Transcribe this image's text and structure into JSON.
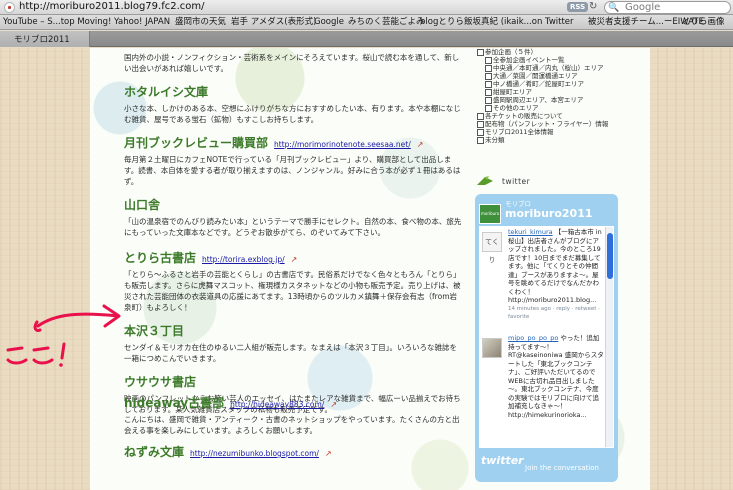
{
  "browser": {
    "url": "http://moriburo2011.blog79.fc2.com/",
    "rss": "RSS",
    "search_placeholder": "Google",
    "bookmarks": [
      "YouTube – S...top Moving!",
      "Yahoo! JAPAN",
      "盛岡市の天気",
      "岩手 アメダス(表形式)",
      "Google",
      "みちのく芸能ごよみ",
      "blogとりら",
      "飯坂真紀 (ikaik...on Twitter",
      "被災者支援チーム...ーEIWATE",
      "とりら画像"
    ],
    "tab_title": "モリブロ2011"
  },
  "main": {
    "top_text": "国内外の小説・ノンフィクション・芸術系をメインにそろえています。桜山で読む本を通して、新しい出会いがあれば嬉しいです。",
    "entries": [
      {
        "name": "ホタルイシ文庫",
        "link": "",
        "desc": "小さな本、しかけのある本、空想にふけりがちな方におすすめしたい本、有ります。本や本棚になじむ雑貨、屋号である蛍石（鉱物）もすこしお持ちします。"
      },
      {
        "name": "月刊ブックレビュー購買部",
        "link": "http://morimorinotenote.seesaa.net/",
        "desc": "毎月第２土曜日にカフェNOTEで行っている「月刊ブックレビュー」より、購買部として出品します。読書、本自体を愛する者が取り揃えますのは、ノンジャンル。好みに合う本が必ず１冊はあるはず。"
      },
      {
        "name": "山口舎",
        "link": "",
        "desc": "「山の温泉宿でのんびり読みたい本」というテーマで勝手にセレクト。自然の本、食べ物の本、旅先にもっていった文庫本などです。どうぞお散歩がてら、のぞいてみて下さい。"
      },
      {
        "name": "とりら古書店",
        "link": "http://torira.exblog.jp/",
        "desc": "「とりら～ふるさと岩手の芸能とくらし」の古書店です。民俗系だけでなく色々ともろん「とりら」も販売します。さらに虎舞マスコット、権現様カスタネットなどの小物も販売予定。売り上げは、被災された芸能団体の衣装道具の応援にあてます。13時頃からのツルカメ鎮舞＋保存会有志（from岩泉町）もよろしく！"
      },
      {
        "name": "本沢３丁目",
        "link": "",
        "desc": "センダイ＆モリオカ在住のゆるい二人組が販売します。なまえは「本沢３丁目」。いろいろな雑誌を一箱につめこんでいきます。"
      },
      {
        "name": "ウサウサ書店",
        "link": "",
        "desc": "映画のパンフレットからお笑い芸人のエッセイ、はたまたレアな雑貨まで、幅広ーい品揃えでお待ちしております。某人気雑貨店スタッフの私物も販売予定です。"
      },
      {
        "name": "hideaway古書部",
        "link": "http://hideaway883.com/",
        "desc": "こんにちは、盛岡で雑貨・アンティーク・古書のネットショップをやっています。たくさんの方と出会える事を楽しみにしています。よろしくお願いします。"
      },
      {
        "name": "ねずみ文庫",
        "link": "http://nezumibunko.blogspot.com/",
        "desc": ""
      }
    ]
  },
  "sidebar": {
    "tree": [
      {
        "label": "参加企画（５件）",
        "indent": false
      },
      {
        "label": "全参加企画イベント一覧",
        "indent": true
      },
      {
        "label": "中央通／本町通／内丸（桜山）エリア",
        "indent": true
      },
      {
        "label": "大通／菜園／開運橋通エリア",
        "indent": true
      },
      {
        "label": "中ノ橋通／肴町／鉈屋町エリア",
        "indent": true
      },
      {
        "label": "紺屋町エリア",
        "indent": true
      },
      {
        "label": "盛岡駅周辺エリア、本宮エリア",
        "indent": true
      },
      {
        "label": "その他のエリア",
        "indent": true
      },
      {
        "label": "各チケットの販売について",
        "indent": false
      },
      {
        "label": "配布物（パンフレット・フライヤー）情報",
        "indent": false
      },
      {
        "label": "モリブロ2011全体情報",
        "indent": false
      },
      {
        "label": "未分類",
        "indent": false
      }
    ],
    "twitter_header": "twitter",
    "widget": {
      "subtitle": "モリブロ",
      "username": "moriburo2011",
      "tweets": [
        {
          "user": "tekuri_kimura",
          "avatar": "てくり",
          "text": "【一箱古本市 in 桜山】出店者さんがブログにアップされました。今のところ19店です！10日までまだ募集してます。他に「てくりとその仲間達」ブースがありますよ～。屋号を眺めてるだけでなんだかわくわく！ http://moriburo2011.blog...",
          "meta": "14 minutes ago · reply · retweet · favorite"
        },
        {
          "user": "mipo_po_po_po",
          "avatar": "",
          "text": "やった！追加持ってます～！ RT@kaseinoniwa 盛岡からスタートした「東北ブックコンテナ」、ご好評いただいてるのでWEBに古切れ品目出しました～。東北ブックコンテナ、今度の実験ではモリブロに向けて追加補充しなきゃ～！ http://himekurinorioka...",
          "meta": ""
        }
      ],
      "logo": "twitter",
      "join": "Join the conversation"
    }
  },
  "annotation": {
    "handwritten": "ここ!",
    "color": "#e8114b"
  }
}
